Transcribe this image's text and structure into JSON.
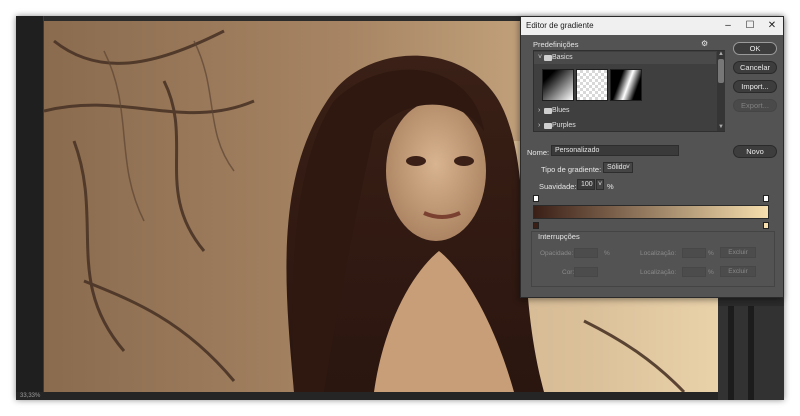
{
  "status_bar": {
    "zoom_text": "33,33%"
  },
  "dialog": {
    "title": "Editor de gradiente",
    "presets": {
      "label": "Predefinições",
      "gear_icon": "gear-icon",
      "groups": [
        {
          "name": "Basics",
          "expanded": true
        },
        {
          "name": "Blues",
          "expanded": false
        },
        {
          "name": "Purples",
          "expanded": false
        }
      ]
    },
    "buttons": {
      "ok": "OK",
      "cancel": "Cancelar",
      "import": "Import...",
      "export": "Export...",
      "new": "Novo"
    },
    "name": {
      "label": "Nome:",
      "value": "Personalizado"
    },
    "type": {
      "label": "Tipo de gradiente:",
      "value": "Sólido"
    },
    "smoothness": {
      "label": "Suavidade:",
      "value": "100",
      "unit": "%"
    },
    "gradient_colors": {
      "start": "#3a1f17",
      "end": "#f7dfae"
    },
    "stops": {
      "label": "Interrupções",
      "opacity_label": "Opacidade:",
      "opacity_unit": "%",
      "location_label": "Localização:",
      "location_unit": "%",
      "delete_label": "Excluir",
      "color_label": "Cor:"
    }
  }
}
